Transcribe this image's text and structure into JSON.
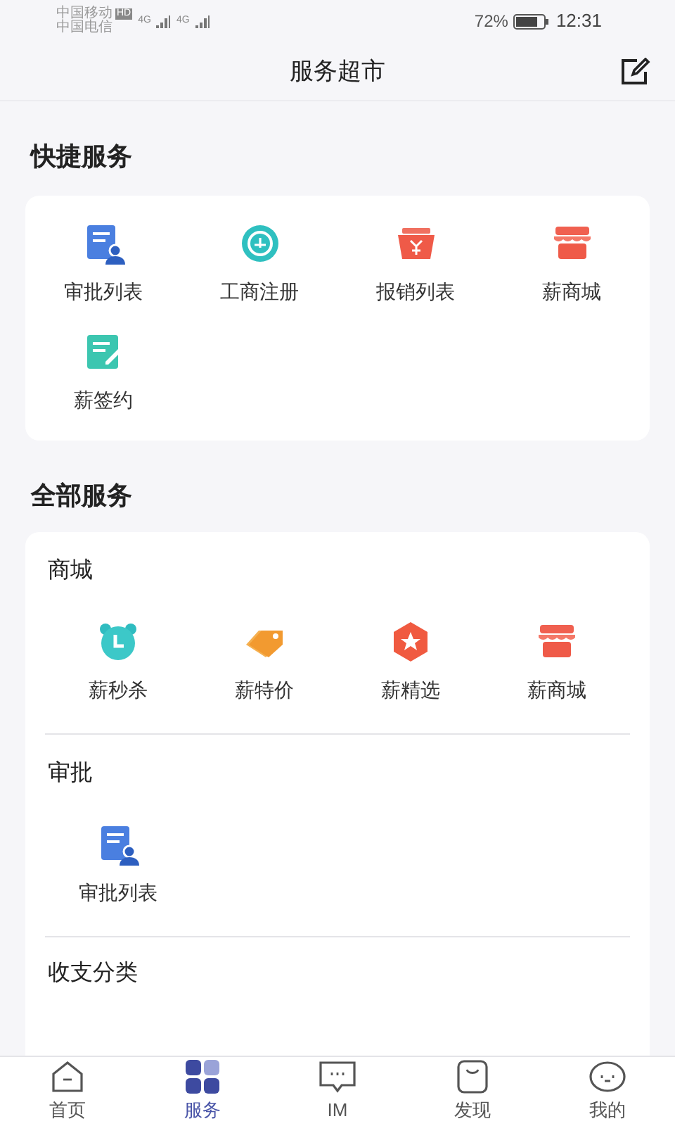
{
  "status_bar": {
    "carrier_1": "中国移动",
    "hd_badge": "HD",
    "carrier_2": "中国电信",
    "network_1": "4G",
    "network_2": "4G",
    "battery_percent": "72%",
    "time": "12:31"
  },
  "header": {
    "title": "服务超市"
  },
  "quick_services": {
    "title": "快捷服务",
    "items": [
      {
        "label": "审批列表",
        "kind": "approval"
      },
      {
        "label": "工商注册",
        "kind": "register"
      },
      {
        "label": "报销列表",
        "kind": "basket"
      },
      {
        "label": "薪商城",
        "kind": "store"
      },
      {
        "label": "薪签约",
        "kind": "sign"
      }
    ]
  },
  "all_services": {
    "title": "全部服务",
    "groups": [
      {
        "title": "商城",
        "items": [
          {
            "label": "薪秒杀",
            "kind": "alarm"
          },
          {
            "label": "薪特价",
            "kind": "tag"
          },
          {
            "label": "薪精选",
            "kind": "star"
          },
          {
            "label": "薪商城",
            "kind": "store"
          }
        ]
      },
      {
        "title": "审批",
        "items": [
          {
            "label": "审批列表",
            "kind": "approval"
          }
        ]
      },
      {
        "title": "收支分类"
      }
    ]
  },
  "tab_bar": [
    {
      "label": "首页",
      "kind": "home",
      "selected": false
    },
    {
      "label": "服务",
      "kind": "grid",
      "selected": true
    },
    {
      "label": "IM",
      "kind": "chat",
      "selected": false
    },
    {
      "label": "发现",
      "kind": "bag",
      "selected": false
    },
    {
      "label": "我的",
      "kind": "face",
      "selected": false
    }
  ]
}
